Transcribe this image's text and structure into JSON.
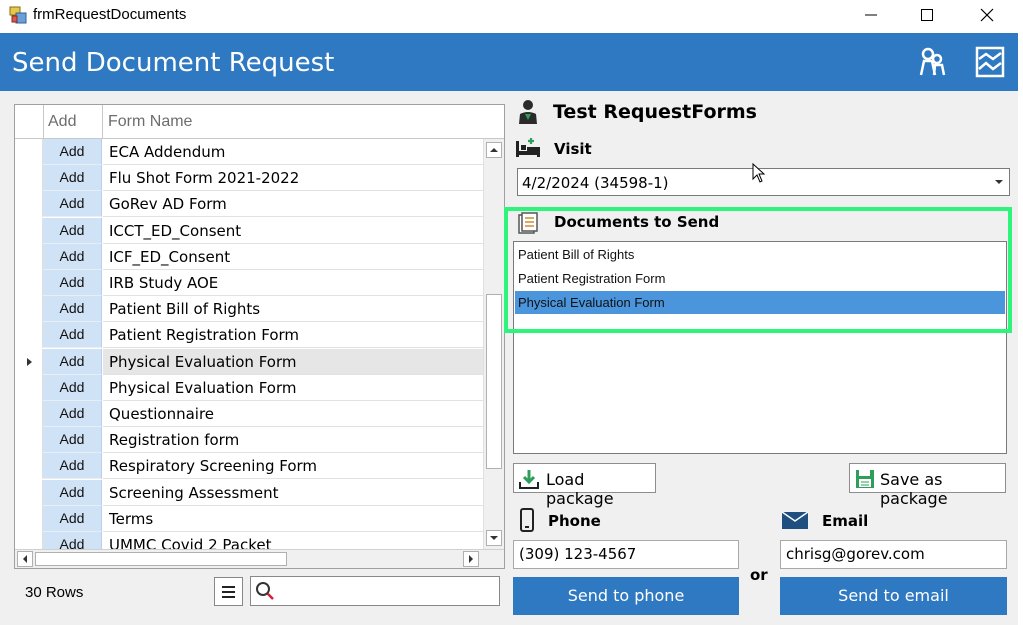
{
  "window": {
    "title": "frmRequestDocuments"
  },
  "header": {
    "title": "Send Document Request"
  },
  "grid": {
    "columns": [
      "Add",
      "Form Name"
    ],
    "add_label": "Add",
    "rows": [
      "ECA Addendum",
      "Flu Shot Form 2021-2022",
      "GoRev AD Form",
      "ICCT_ED_Consent",
      "ICF_ED_Consent",
      "IRB Study AOE",
      "Patient Bill of Rights",
      "Patient Registration Form",
      "Physical Evaluation Form",
      "Physical Evaluation Form",
      "Questionnaire",
      "Registration form",
      "Respiratory Screening Form",
      "Screening Assessment",
      "Terms",
      "UMMC Covid 2 Packet"
    ],
    "current_row": 8,
    "row_count": "30 Rows"
  },
  "patient": {
    "name": "Test RequestForms"
  },
  "visit": {
    "label": "Visit",
    "selected": "4/2/2024 (34598-1)"
  },
  "documents": {
    "label": "Documents to Send",
    "items": [
      "Patient Bill of Rights",
      "Patient Registration Form",
      "Physical Evaluation Form"
    ],
    "selected_index": 2
  },
  "buttons": {
    "load_package": "Load package",
    "save_package": "Save as package",
    "send_phone": "Send to phone",
    "send_email": "Send to email"
  },
  "contact": {
    "phone_label": "Phone",
    "phone_value": "(309) 123-4567",
    "email_label": "Email",
    "email_value": "chrisg@gorev.com",
    "or_label": "or"
  },
  "colors": {
    "header_blue": "#2e79c1",
    "selection_blue": "#4a95dc",
    "highlight_green": "#2ff47b",
    "add_cell": "#d0e2f5"
  }
}
